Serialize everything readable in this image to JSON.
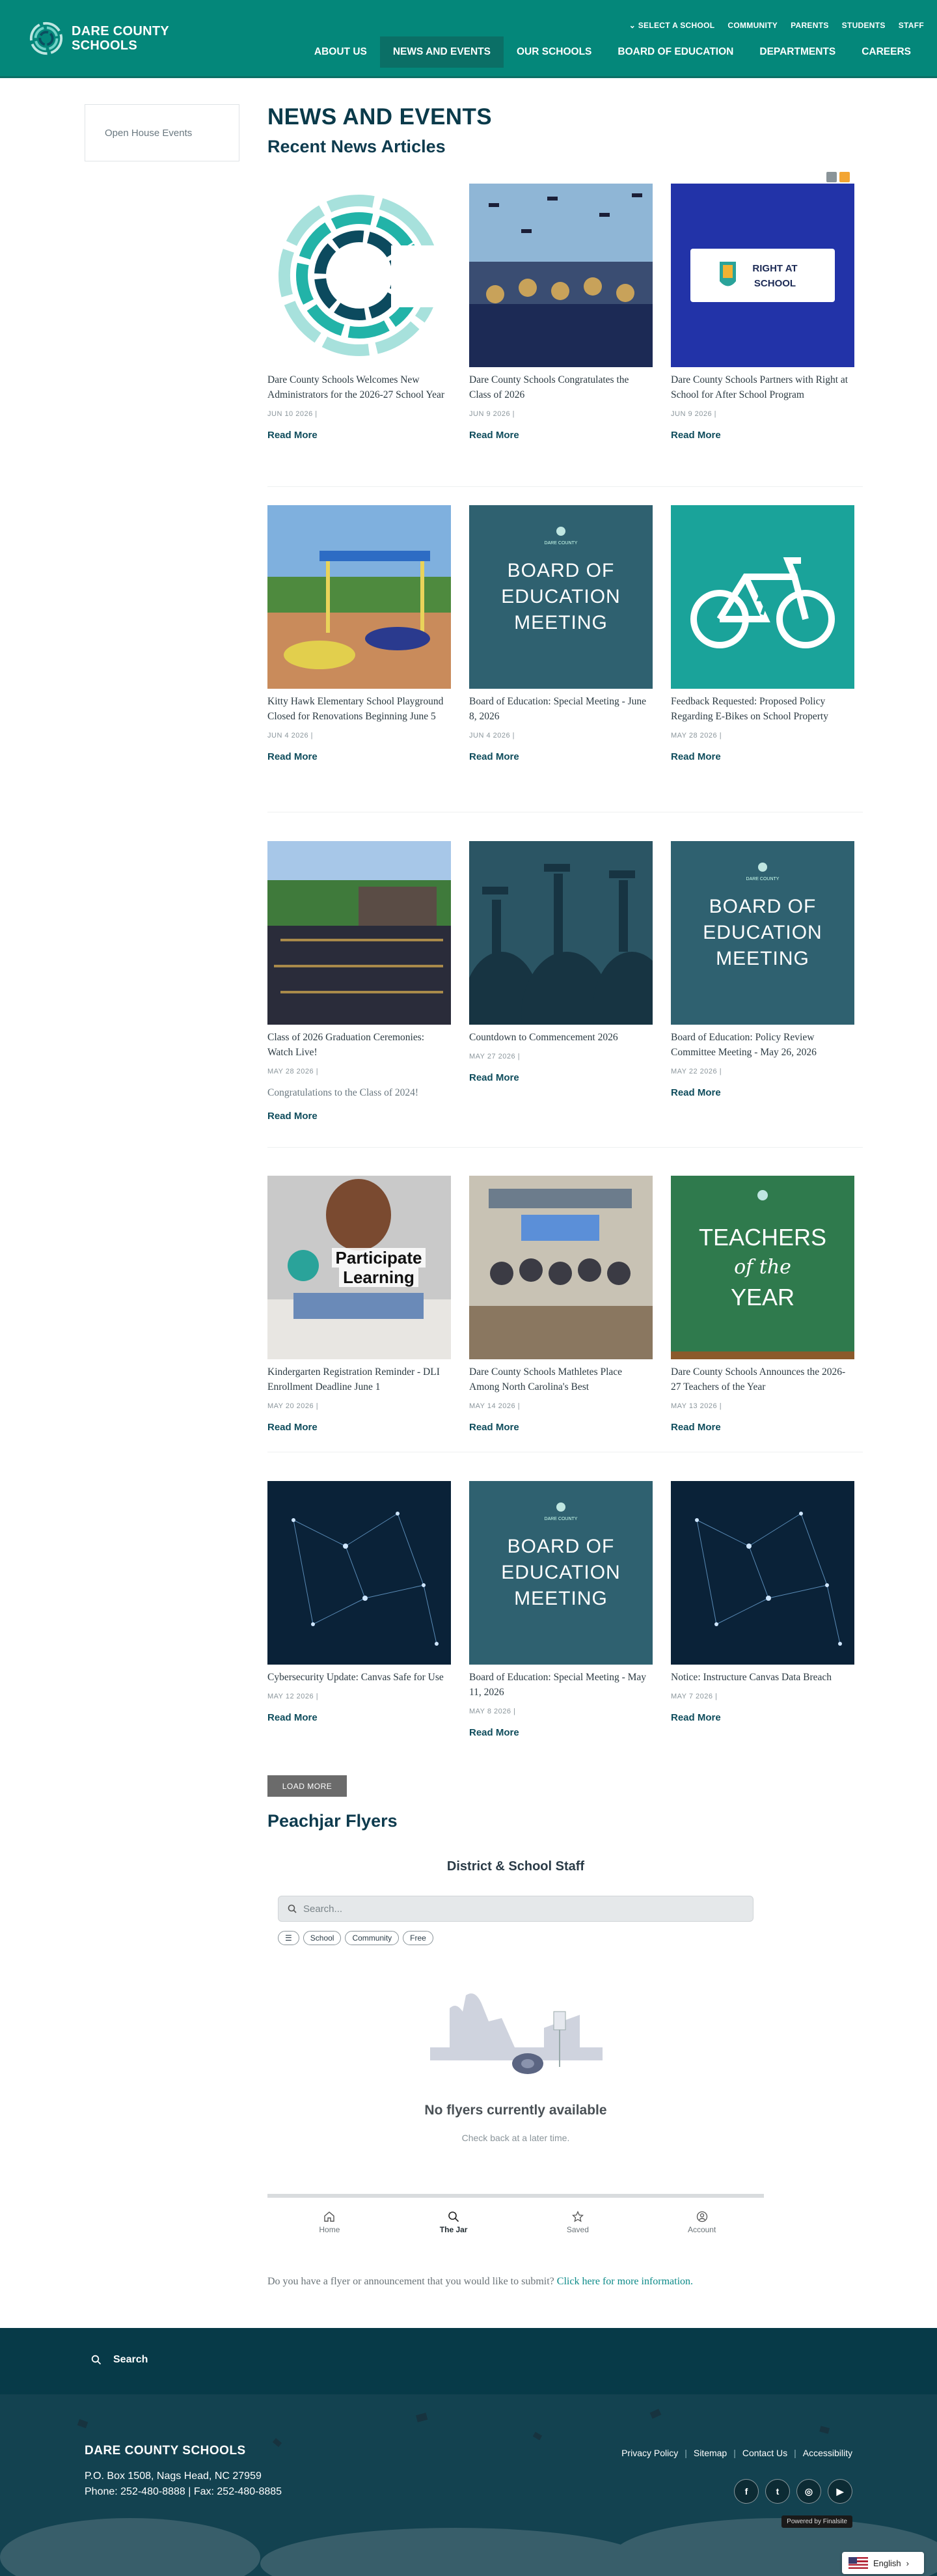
{
  "header": {
    "logo_line1": "DARE COUNTY",
    "logo_line2": "SCHOOLS",
    "util": [
      "SELECT A SCHOOL",
      "COMMUNITY",
      "PARENTS",
      "STUDENTS",
      "STAFF"
    ],
    "nav": [
      "ABOUT US",
      "NEWS AND EVENTS",
      "OUR SCHOOLS",
      "BOARD OF EDUCATION",
      "DEPARTMENTS",
      "CAREERS"
    ],
    "active_nav": "NEWS AND EVENTS"
  },
  "sidebar": {
    "item": "Open House Events"
  },
  "main": {
    "page_title": "NEWS AND EVENTS",
    "section_title": "Recent News Articles"
  },
  "articles": [
    {
      "title": "Dare County Schools Welcomes New Administrators for the 2026-27 School Year",
      "date": "JUN 10 2026 |",
      "more": "Read More",
      "thumb": "logo-c"
    },
    {
      "title": "Dare County Schools Congratulates the Class of 2026",
      "date": "JUN 9 2026 |",
      "more": "Read More",
      "thumb": "grads-photo"
    },
    {
      "title": "Dare County Schools Partners with Right at School for After School Program",
      "date": "JUN 9 2026 |",
      "more": "Read More",
      "thumb": "right-at-school",
      "thumb_text": [
        "RIGHT AT",
        "SCHOOL"
      ]
    },
    {
      "title": "Kitty Hawk Elementary School Playground Closed for Renovations Beginning June 5",
      "date": "JUN 4 2026 |",
      "more": "Read More",
      "thumb": "playground-photo"
    },
    {
      "title": "Board of Education: Special Meeting - June 8, 2026",
      "date": "JUN 4 2026 |",
      "more": "Read More",
      "thumb": "board-meeting",
      "thumb_text": [
        "BOARD OF",
        "EDUCATION",
        "MEETING"
      ]
    },
    {
      "title": "Feedback Requested: Proposed Policy Regarding E-Bikes on School Property",
      "date": "MAY 28 2026 |",
      "more": "Read More",
      "thumb": "ebike"
    },
    {
      "title": "Class of 2026 Graduation Ceremonies: Watch Live!",
      "date": "MAY 28 2026 |",
      "excerpt": "Congratulations to the Class of 2024!",
      "more": "Read More",
      "thumb": "ceremony-photo"
    },
    {
      "title": "Countdown to Commencement 2026",
      "date": "MAY 27 2026 |",
      "more": "Read More",
      "thumb": "silhouettes"
    },
    {
      "title": "Board of Education: Policy Review Committee Meeting - May 26, 2026",
      "date": "MAY 22 2026 |",
      "more": "Read More",
      "thumb": "board-meeting",
      "thumb_text": [
        "BOARD OF",
        "EDUCATION",
        "MEETING"
      ]
    },
    {
      "title": "Kindergarten Registration Reminder - DLI Enrollment Deadline June 1",
      "date": "MAY 20 2026 |",
      "more": "Read More",
      "thumb": "participate",
      "thumb_text": [
        "Participate",
        "Learning"
      ]
    },
    {
      "title": "Dare County Schools Mathletes Place Among North Carolina's Best",
      "date": "MAY 14 2026 |",
      "more": "Read More",
      "thumb": "mathletes-photo"
    },
    {
      "title": "Dare County Schools Announces the 2026-27 Teachers of the Year",
      "date": "MAY 13 2026 |",
      "more": "Read More",
      "thumb": "teachers",
      "thumb_text": [
        "TEACHERS",
        "of the",
        "YEAR"
      ]
    },
    {
      "title": "Cybersecurity Update: Canvas Safe for Use",
      "date": "MAY 12 2026 |",
      "more": "Read More",
      "thumb": "network"
    },
    {
      "title": "Board of Education: Special Meeting - May 11, 2026",
      "date": "MAY 8 2026 |",
      "more": "Read More",
      "thumb": "board-meeting",
      "thumb_text": [
        "BOARD OF",
        "EDUCATION",
        "MEETING"
      ]
    },
    {
      "title": "Notice: Instructure Canvas Data Breach",
      "date": "MAY 7 2026 |",
      "more": "Read More",
      "thumb": "network"
    }
  ],
  "load_more": "LOAD MORE",
  "peachjar": {
    "heading": "Peachjar Flyers",
    "widget_title": "District & School Staff",
    "search_placeholder": "Search...",
    "chips": [
      "School",
      "Community",
      "Free"
    ],
    "empty_title": "No flyers currently available",
    "empty_sub": "Check back at a later time.",
    "tabs": [
      {
        "label": "Home",
        "icon": "home-icon"
      },
      {
        "label": "The Jar",
        "icon": "search-icon"
      },
      {
        "label": "Saved",
        "icon": "star-icon"
      },
      {
        "label": "Account",
        "icon": "account-icon"
      }
    ],
    "active_tab": "The Jar",
    "submit_text": "Do you have a flyer or announcement that you would like to submit?",
    "submit_link": "Click here for more information."
  },
  "footer": {
    "search_label": "Search",
    "name": "DARE COUNTY SCHOOLS",
    "address": "P.O. Box 1508, Nags Head, NC 27959",
    "phone": "Phone: 252-480-8888  |  Fax: 252-480-8885",
    "links": [
      "Privacy Policy",
      "Sitemap",
      "Contact Us",
      "Accessibility"
    ],
    "social": [
      "facebook-icon",
      "twitter-icon",
      "instagram-icon",
      "youtube-icon"
    ],
    "powered": "Powered by Finalsite",
    "language": "English"
  },
  "colors": {
    "header": "#04877a",
    "nav_active": "#0b6f66",
    "title": "#0a3a4a",
    "footer": "#0d3e4b",
    "search_band": "#073a48",
    "link": "#0b8a88"
  }
}
